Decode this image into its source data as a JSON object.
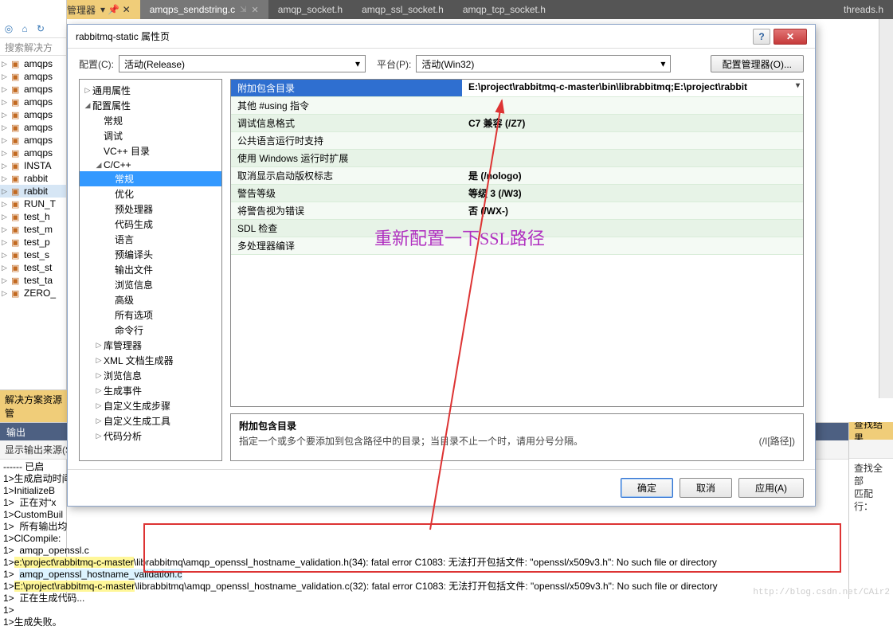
{
  "tabs": {
    "left_panel_title": "解决方案资源管理器",
    "items": [
      "amqps_sendstring.c",
      "amqp_socket.h",
      "amqp_ssl_socket.h",
      "amqp_tcp_socket.h",
      "threads.h"
    ]
  },
  "solution_explorer": {
    "search_placeholder": "搜索解决方案资",
    "footer": "解决方案资源管",
    "items": [
      "amqps",
      "amqps",
      "amqps",
      "amqps",
      "amqps",
      "amqps",
      "amqps",
      "amqps",
      "INSTA",
      "rabbit",
      "rabbit",
      "RUN_T",
      "test_h",
      "test_m",
      "test_p",
      "test_s",
      "test_st",
      "test_ta",
      "ZERO_"
    ],
    "selected_index": 10
  },
  "dialog": {
    "title": "rabbitmq-static 属性页",
    "config_label": "配置(C):",
    "config_value": "活动(Release)",
    "platform_label": "平台(P):",
    "platform_value": "活动(Win32)",
    "config_manager": "配置管理器(O)...",
    "tree": [
      {
        "label": "通用属性",
        "level": 0,
        "exp": "▷"
      },
      {
        "label": "配置属性",
        "level": 0,
        "exp": "◢"
      },
      {
        "label": "常规",
        "level": 1,
        "exp": ""
      },
      {
        "label": "调试",
        "level": 1,
        "exp": ""
      },
      {
        "label": "VC++ 目录",
        "level": 1,
        "exp": ""
      },
      {
        "label": "C/C++",
        "level": 1,
        "exp": "◢"
      },
      {
        "label": "常规",
        "level": 2,
        "exp": "",
        "selected": true
      },
      {
        "label": "优化",
        "level": 2,
        "exp": ""
      },
      {
        "label": "预处理器",
        "level": 2,
        "exp": ""
      },
      {
        "label": "代码生成",
        "level": 2,
        "exp": ""
      },
      {
        "label": "语言",
        "level": 2,
        "exp": ""
      },
      {
        "label": "预编译头",
        "level": 2,
        "exp": ""
      },
      {
        "label": "输出文件",
        "level": 2,
        "exp": ""
      },
      {
        "label": "浏览信息",
        "level": 2,
        "exp": ""
      },
      {
        "label": "高级",
        "level": 2,
        "exp": ""
      },
      {
        "label": "所有选项",
        "level": 2,
        "exp": ""
      },
      {
        "label": "命令行",
        "level": 2,
        "exp": ""
      },
      {
        "label": "库管理器",
        "level": 1,
        "exp": "▷"
      },
      {
        "label": "XML 文档生成器",
        "level": 1,
        "exp": "▷"
      },
      {
        "label": "浏览信息",
        "level": 1,
        "exp": "▷"
      },
      {
        "label": "生成事件",
        "level": 1,
        "exp": "▷"
      },
      {
        "label": "自定义生成步骤",
        "level": 1,
        "exp": "▷"
      },
      {
        "label": "自定义生成工具",
        "level": 1,
        "exp": "▷"
      },
      {
        "label": "代码分析",
        "level": 1,
        "exp": "▷"
      }
    ],
    "grid": [
      {
        "k": "附加包含目录",
        "v": "E:\\project\\rabbitmq-c-master\\bin\\librabbitmq;E:\\project\\rabbit",
        "selected": true
      },
      {
        "k": "其他 #using 指令",
        "v": ""
      },
      {
        "k": "调试信息格式",
        "v": "C7 兼容 (/Z7)"
      },
      {
        "k": "公共语言运行时支持",
        "v": ""
      },
      {
        "k": "使用 Windows 运行时扩展",
        "v": ""
      },
      {
        "k": "取消显示启动版权标志",
        "v": "是 (/nologo)"
      },
      {
        "k": "警告等级",
        "v": "等级 3 (/W3)"
      },
      {
        "k": "将警告视为错误",
        "v": "否 (/WX-)"
      },
      {
        "k": "SDL 检查",
        "v": ""
      },
      {
        "k": "多处理器编译",
        "v": ""
      }
    ],
    "desc": {
      "title": "附加包含目录",
      "text": "指定一个或多个要添加到包含路径中的目录；当目录不止一个时，请用分号分隔。",
      "flags": "(/I[路径])"
    },
    "buttons": {
      "ok": "确定",
      "cancel": "取消",
      "apply": "应用(A)"
    }
  },
  "output": {
    "header": "输出",
    "toolbar_label": "显示输出来源(S",
    "lines": [
      "------ 已启",
      "1>生成启动时间",
      "1>InitializeB",
      "1>  正在对“x",
      "1>CustomBuil",
      "1>  所有输出均",
      "1>ClCompile:",
      "1>  amqp_openssl.c",
      "1>e:\\project\\rabbitmq-c-master\\librabbitmq\\amqp_openssl_hostname_validation.h(34): fatal error C1083: 无法打开包括文件: \"openssl/x509v3.h\": No such file or directory",
      "1>  amqp_openssl_hostname_validation.c",
      "1>E:\\project\\rabbitmq-c-master\\librabbitmq\\amqp_openssl_hostname_validation.c(32): fatal error C1083: 无法打开包括文件: \"openssl/x509v3.h\": No such file or directory",
      "1>  正在生成代码...",
      "1>",
      "1>生成失败。"
    ]
  },
  "annotation": "重新配置一下SSL路径",
  "find": {
    "header": "查找结果",
    "line1": "查找全部",
    "line2": "匹配行："
  },
  "watermark": "http://blog.csdn.net/CAir2"
}
